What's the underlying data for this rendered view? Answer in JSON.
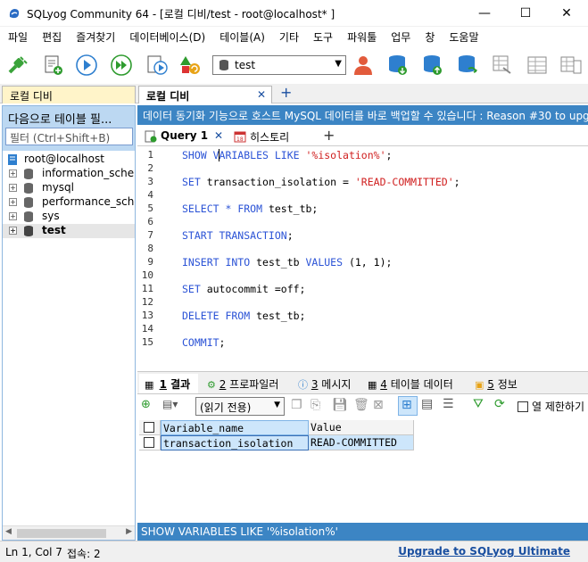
{
  "window": {
    "title": "SQLyog Community 64 - [로컬 디비/test - root@localhost* ]",
    "minimize": "—",
    "maximize": "☐",
    "close": "✕"
  },
  "menu": [
    "파일",
    "편집",
    "즐겨찾기",
    "데이터베이스(D)",
    "테이블(A)",
    "기타",
    "도구",
    "파워툴",
    "업무",
    "창",
    "도움말"
  ],
  "toolbar": {
    "database_selected": "test"
  },
  "connection_tabs": [
    {
      "label": "로컬 디비",
      "active": false
    },
    {
      "label": "로컬 디비",
      "active": true,
      "close": "✕"
    }
  ],
  "connection_add": "+",
  "object_browser": {
    "header": "다음으로 테이블 필...",
    "filter_placeholder": "필터 (Ctrl+Shift+B)",
    "root": "root@localhost",
    "databases": [
      "information_schema",
      "mysql",
      "performance_schema",
      "sys",
      "test"
    ],
    "selected": "test"
  },
  "info_bar": "데이터 동기화 기능으로 호스트 MySQL 데이터를 바로 백업할 수 있습니다 : Reason #30 to upg...",
  "query_tabs": [
    {
      "label": "Query 1",
      "active": true,
      "close": "✕"
    },
    {
      "label": "히스토리",
      "active": false
    }
  ],
  "query_add": "+",
  "editor": {
    "line_numbers": [
      "1",
      "2",
      "3",
      "4",
      "5",
      "6",
      "7",
      "8",
      "9",
      "10",
      "11",
      "12",
      "13",
      "14",
      "15"
    ],
    "lines": [
      [
        {
          "t": "SHOW VARIABLES LIKE ",
          "k": 1
        },
        {
          "t": "'%isolation%'",
          "s": 1
        },
        {
          "t": ";"
        }
      ],
      [],
      [
        {
          "t": "SET ",
          "k": 1
        },
        {
          "t": "transaction_isolation = "
        },
        {
          "t": "'READ-COMMITTED'",
          "s": 1
        },
        {
          "t": ";"
        }
      ],
      [],
      [
        {
          "t": "SELECT ",
          "k": 1
        },
        {
          "t": "* ",
          "k": 1
        },
        {
          "t": "FROM ",
          "k": 1
        },
        {
          "t": "test_tb;"
        }
      ],
      [],
      [
        {
          "t": "START TRANSACTION",
          "k": 1
        },
        {
          "t": ";"
        }
      ],
      [],
      [
        {
          "t": "INSERT INTO ",
          "k": 1
        },
        {
          "t": "test_tb "
        },
        {
          "t": "VALUES ",
          "k": 1
        },
        {
          "t": "(1, 1);"
        }
      ],
      [],
      [
        {
          "t": "SET ",
          "k": 1
        },
        {
          "t": "autocommit =off;"
        }
      ],
      [],
      [
        {
          "t": "DELETE FROM ",
          "k": 1
        },
        {
          "t": "test_tb;"
        }
      ],
      [],
      [
        {
          "t": "COMMIT",
          "k": 1
        },
        {
          "t": ";"
        }
      ]
    ]
  },
  "result_tabs": [
    {
      "num": "1",
      "label": "결과",
      "active": true
    },
    {
      "num": "2",
      "label": "프로파일러",
      "active": false
    },
    {
      "num": "3",
      "label": "메시지",
      "active": false
    },
    {
      "num": "4",
      "label": "테이블 데이터",
      "active": false
    },
    {
      "num": "5",
      "label": "정보",
      "active": false
    }
  ],
  "result_toolbar": {
    "mode": "(읽기 전용)",
    "limit_label": "열 제한하기"
  },
  "grid": {
    "columns": [
      "Variable_name",
      "Value"
    ],
    "rows": [
      [
        "transaction_isolation",
        "READ-COMMITTED"
      ]
    ]
  },
  "status_message": "SHOW VARIABLES LIKE '%isolation%'",
  "statusbar": {
    "position": "Ln 1, Col 7",
    "connections": "접속: 2",
    "upgrade": "Upgrade to SQLyog Ultimate"
  },
  "colors": {
    "accent_blue": "#3c85c4",
    "panel_blue": "#bcd8f2",
    "keyword": "#2b53d6",
    "string": "#d02020",
    "upgrade_link": "#1a4fa0"
  }
}
